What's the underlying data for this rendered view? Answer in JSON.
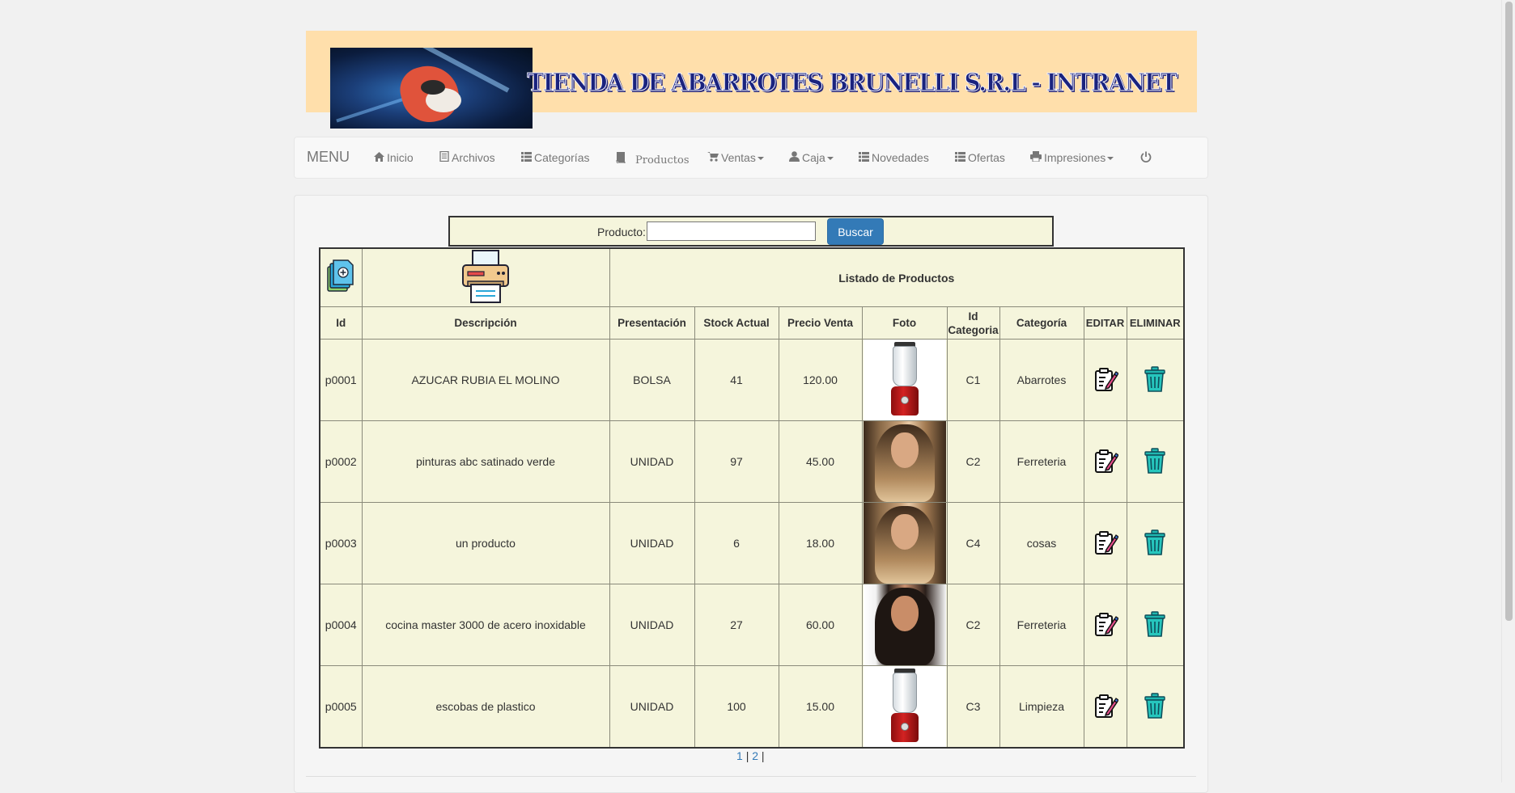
{
  "header": {
    "title": "TIENDA DE ABARROTES BRUNELLI S.R.L - INTRANET"
  },
  "nav": {
    "brand": "MENU",
    "items": [
      {
        "label": "Inicio",
        "icon": "home-icon"
      },
      {
        "label": "Archivos",
        "icon": "book-icon"
      },
      {
        "label": "Categorías",
        "icon": "list-icon"
      },
      {
        "label": "Productos",
        "icon": "book-icon"
      },
      {
        "label": "Ventas",
        "icon": "cart-icon",
        "dropdown": true
      },
      {
        "label": "Caja",
        "icon": "user-icon",
        "dropdown": true
      },
      {
        "label": "Novedades",
        "icon": "list-icon"
      },
      {
        "label": "Ofertas",
        "icon": "list-icon"
      },
      {
        "label": "Impresiones",
        "icon": "print-icon",
        "dropdown": true
      },
      {
        "label": "",
        "icon": "power-icon"
      }
    ]
  },
  "search": {
    "label": "Producto:",
    "value": "",
    "placeholder": "",
    "button": "Buscar"
  },
  "table": {
    "title": "Listado de Productos",
    "headers": [
      "Id",
      "Descripción",
      "Presentación",
      "Stock Actual",
      "Precio Venta",
      "Foto",
      "Id Categoria",
      "Categoría",
      "EDITAR",
      "ELIMINAR"
    ],
    "rows": [
      {
        "id": "p0001",
        "descripcion": "AZUCAR RUBIA EL MOLINO",
        "presentacion": "BOLSA",
        "stock": "41",
        "precio": "120.00",
        "foto": "blender",
        "id_categoria": "C1",
        "categoria": "Abarrotes"
      },
      {
        "id": "p0002",
        "descripcion": "pinturas abc satinado verde",
        "presentacion": "UNIDAD",
        "stock": "97",
        "precio": "45.00",
        "foto": "woman1",
        "id_categoria": "C2",
        "categoria": "Ferreteria"
      },
      {
        "id": "p0003",
        "descripcion": "un producto",
        "presentacion": "UNIDAD",
        "stock": "6",
        "precio": "18.00",
        "foto": "woman1",
        "id_categoria": "C4",
        "categoria": "cosas"
      },
      {
        "id": "p0004",
        "descripcion": "cocina master 3000 de acero inoxidable",
        "presentacion": "UNIDAD",
        "stock": "27",
        "precio": "60.00",
        "foto": "woman2",
        "id_categoria": "C2",
        "categoria": "Ferreteria"
      },
      {
        "id": "p0005",
        "descripcion": "escobas de plastico",
        "presentacion": "UNIDAD",
        "stock": "100",
        "precio": "15.00",
        "foto": "blender",
        "id_categoria": "C3",
        "categoria": "Limpieza"
      }
    ]
  },
  "pagination": {
    "pages": [
      "1",
      "2"
    ],
    "separator": "|"
  }
}
